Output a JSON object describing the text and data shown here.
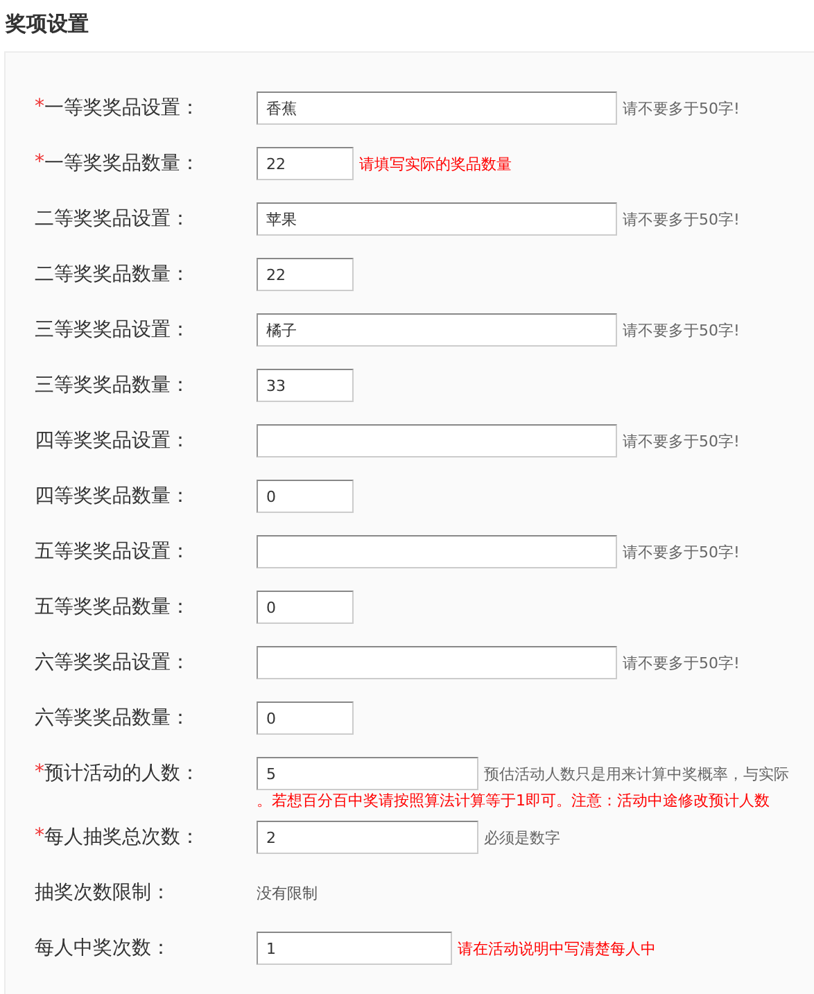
{
  "section_title": "奖项设置",
  "rows": [
    {
      "kind": "prize-name",
      "marker": "*",
      "label": "一等奖奖品设置：",
      "value": "香蕉",
      "hint": {
        "text": "请不要多于50字!",
        "warning": false
      }
    },
    {
      "kind": "prize-count",
      "marker": "*",
      "label": "一等奖奖品数量：",
      "value": "22",
      "hint": {
        "text": "请填写实际的奖品数量",
        "warning": true
      }
    },
    {
      "kind": "prize-name",
      "label": "二等奖奖品设置：",
      "value": "苹果",
      "hint": {
        "text": "请不要多于50字!",
        "warning": false
      }
    },
    {
      "kind": "prize-count",
      "label": "二等奖奖品数量：",
      "value": "22"
    },
    {
      "kind": "prize-name",
      "label": "三等奖奖品设置：",
      "value": "橘子",
      "hint": {
        "text": "请不要多于50字!",
        "warning": false
      }
    },
    {
      "kind": "prize-count",
      "label": "三等奖奖品数量：",
      "value": "33"
    },
    {
      "kind": "prize-name",
      "label": "四等奖奖品设置：",
      "hint": {
        "text": "请不要多于50字!",
        "warning": false
      }
    },
    {
      "kind": "prize-count",
      "label": "四等奖奖品数量：",
      "value": "0"
    },
    {
      "kind": "prize-name",
      "label": "五等奖奖品设置：",
      "hint": {
        "text": "请不要多于50字!",
        "warning": false
      }
    },
    {
      "kind": "prize-count",
      "label": "五等奖奖品数量：",
      "value": "0"
    },
    {
      "kind": "prize-name",
      "label": "六等奖奖品设置：",
      "hint": {
        "text": "请不要多于50字!",
        "warning": false
      }
    },
    {
      "kind": "prize-count",
      "label": "六等奖奖品数量：",
      "value": "0"
    },
    {
      "kind": "people",
      "marker": "*",
      "label": "预计活动的人数：",
      "value": "5",
      "hint": {
        "text": "预估活动人数只是用来计算中奖概率，与实际",
        "warning": false
      },
      "note_below": {
        "text": "。若想百分百中奖请按照算法计算等于1即可。注意：活动中途修改预计人数",
        "warning": true
      }
    },
    {
      "kind": "people",
      "marker": "*",
      "label": "每人抽奖总次数：",
      "value": "2",
      "hint": {
        "text": "必须是数字",
        "warning": false
      }
    },
    {
      "kind": "static",
      "label": "抽奖次数限制：",
      "value": "没有限制"
    },
    {
      "kind": "wins",
      "label": "每人中奖次数：",
      "value": "1",
      "hint": {
        "text": "请在活动说明中写清楚每人中",
        "warning": true
      }
    }
  ]
}
